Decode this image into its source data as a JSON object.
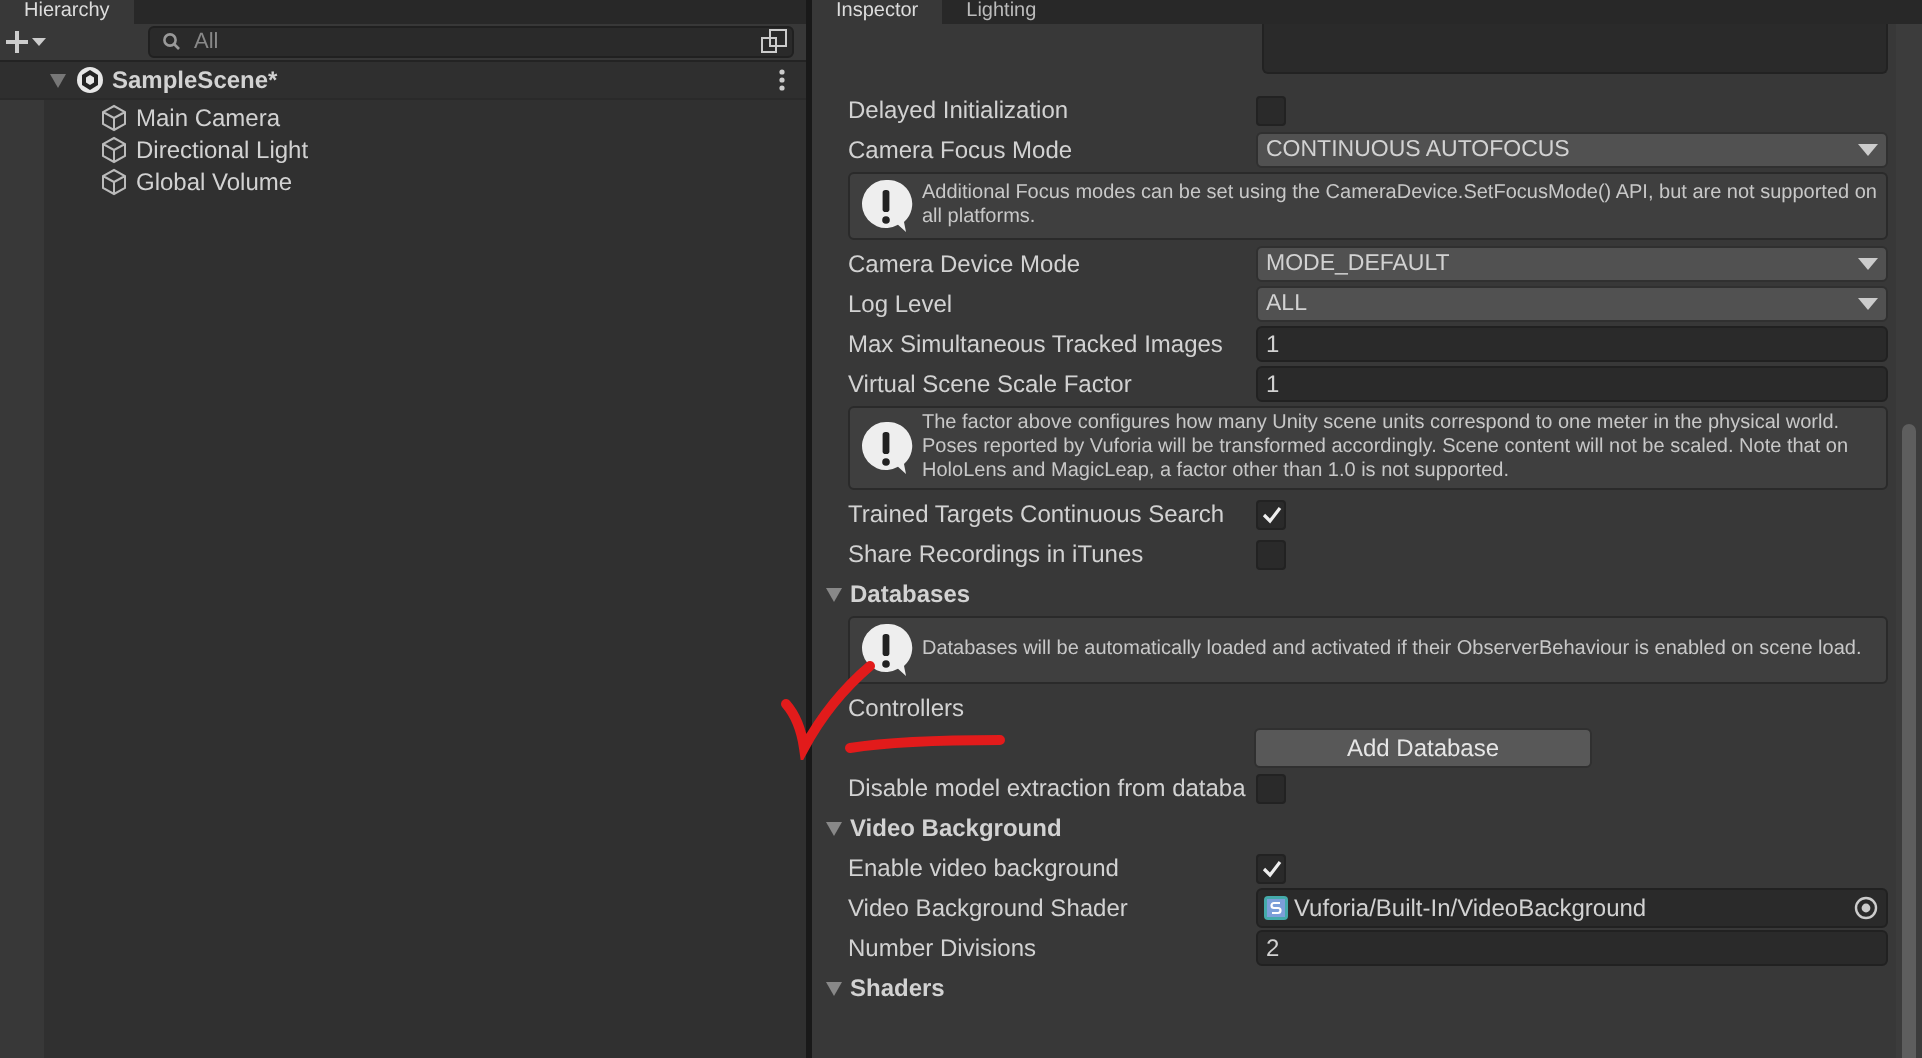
{
  "left_tabs": [
    {
      "label": "Hierarchy",
      "selected": true
    }
  ],
  "hierarchy": {
    "search": {
      "placeholder": "All"
    },
    "scene": {
      "name": "SampleScene*",
      "expanded": true,
      "children": [
        {
          "name": "Main Camera"
        },
        {
          "name": "Directional Light"
        },
        {
          "name": "Global Volume"
        }
      ]
    }
  },
  "right_tabs": [
    {
      "label": "Inspector",
      "selected": true
    },
    {
      "label": "Lighting",
      "selected": false
    }
  ],
  "inspector": {
    "rows": [
      {
        "kind": "textarea"
      },
      {
        "kind": "checkbox",
        "label": "Delayed Initialization",
        "checked": false
      },
      {
        "kind": "dropdown",
        "label": "Camera Focus Mode",
        "value": "CONTINUOUS AUTOFOCUS"
      },
      {
        "kind": "help",
        "text": "Additional Focus modes can be set using the CameraDevice.SetFocusMode() API, but are not supported on all platforms."
      },
      {
        "kind": "dropdown",
        "label": "Camera Device Mode",
        "value": "MODE_DEFAULT"
      },
      {
        "kind": "dropdown",
        "label": "Log Level",
        "value": "ALL"
      },
      {
        "kind": "number",
        "label": "Max Simultaneous Tracked Images",
        "value": "1"
      },
      {
        "kind": "number",
        "label": "Virtual Scene Scale Factor",
        "value": "1"
      },
      {
        "kind": "help",
        "text": "The factor above configures how many Unity scene units correspond to one meter in the physical world. Poses reported by Vuforia will be transformed accordingly. Scene content will not be scaled. Note that on HoloLens and MagicLeap, a factor other than 1.0 is not supported."
      },
      {
        "kind": "checkbox",
        "label": "Trained Targets Continuous Search",
        "checked": true
      },
      {
        "kind": "checkbox",
        "label": "Share Recordings in iTunes",
        "checked": false
      },
      {
        "kind": "header",
        "label": "Databases",
        "expanded": true
      },
      {
        "kind": "help",
        "text": "Databases will be automatically loaded and activated if their ObserverBehaviour is enabled on scene load."
      },
      {
        "kind": "label",
        "label": "Controllers"
      },
      {
        "kind": "button",
        "label": "Add Database"
      },
      {
        "kind": "checkbox",
        "label": "Disable model extraction from databa",
        "checked": false
      },
      {
        "kind": "header",
        "label": "Video Background",
        "expanded": true
      },
      {
        "kind": "checkbox",
        "label": "Enable video background",
        "checked": true
      },
      {
        "kind": "object",
        "label": "Video Background Shader",
        "value": "Vuforia/Built-In/VideoBackground"
      },
      {
        "kind": "number",
        "label": "Number Divisions",
        "value": "2"
      },
      {
        "kind": "header",
        "label": "Shaders",
        "expanded": true
      }
    ]
  }
}
